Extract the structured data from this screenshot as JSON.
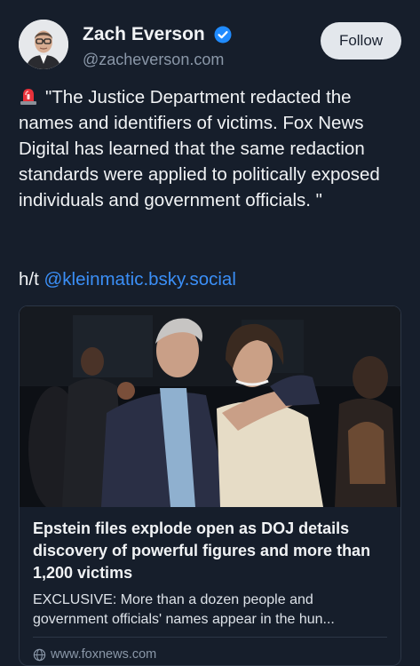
{
  "author": {
    "display_name": "Zach Everson",
    "handle": "@zacheverson.com",
    "avatar_icon": "person-avatar",
    "verified_icon": "verified-check-icon"
  },
  "follow_label": "Follow",
  "post": {
    "siren_icon": "police-siren-emoji",
    "text": "\"The Justice Department redacted the names and identifiers of victims. Fox News Digital has learned that the same redaction standards were applied to politically exposed individuals and government officials. \"",
    "ht_prefix": "h/t ",
    "mention": "@kleinmatic.bsky.social"
  },
  "link_card": {
    "title": "Epstein files explode open as DOJ details discovery of powerful figures and more than 1,200 victims",
    "description": "EXCLUSIVE: More than a dozen people and government officials' names appear in the hun...",
    "domain": "www.foxnews.com",
    "domain_icon": "globe-icon"
  },
  "colors": {
    "background": "#161e2b",
    "text": "#f1f3f5",
    "muted": "#8a97a8",
    "link": "#3b8ff7",
    "verified": "#208bfe",
    "follow_bg": "#e3e7ec"
  }
}
